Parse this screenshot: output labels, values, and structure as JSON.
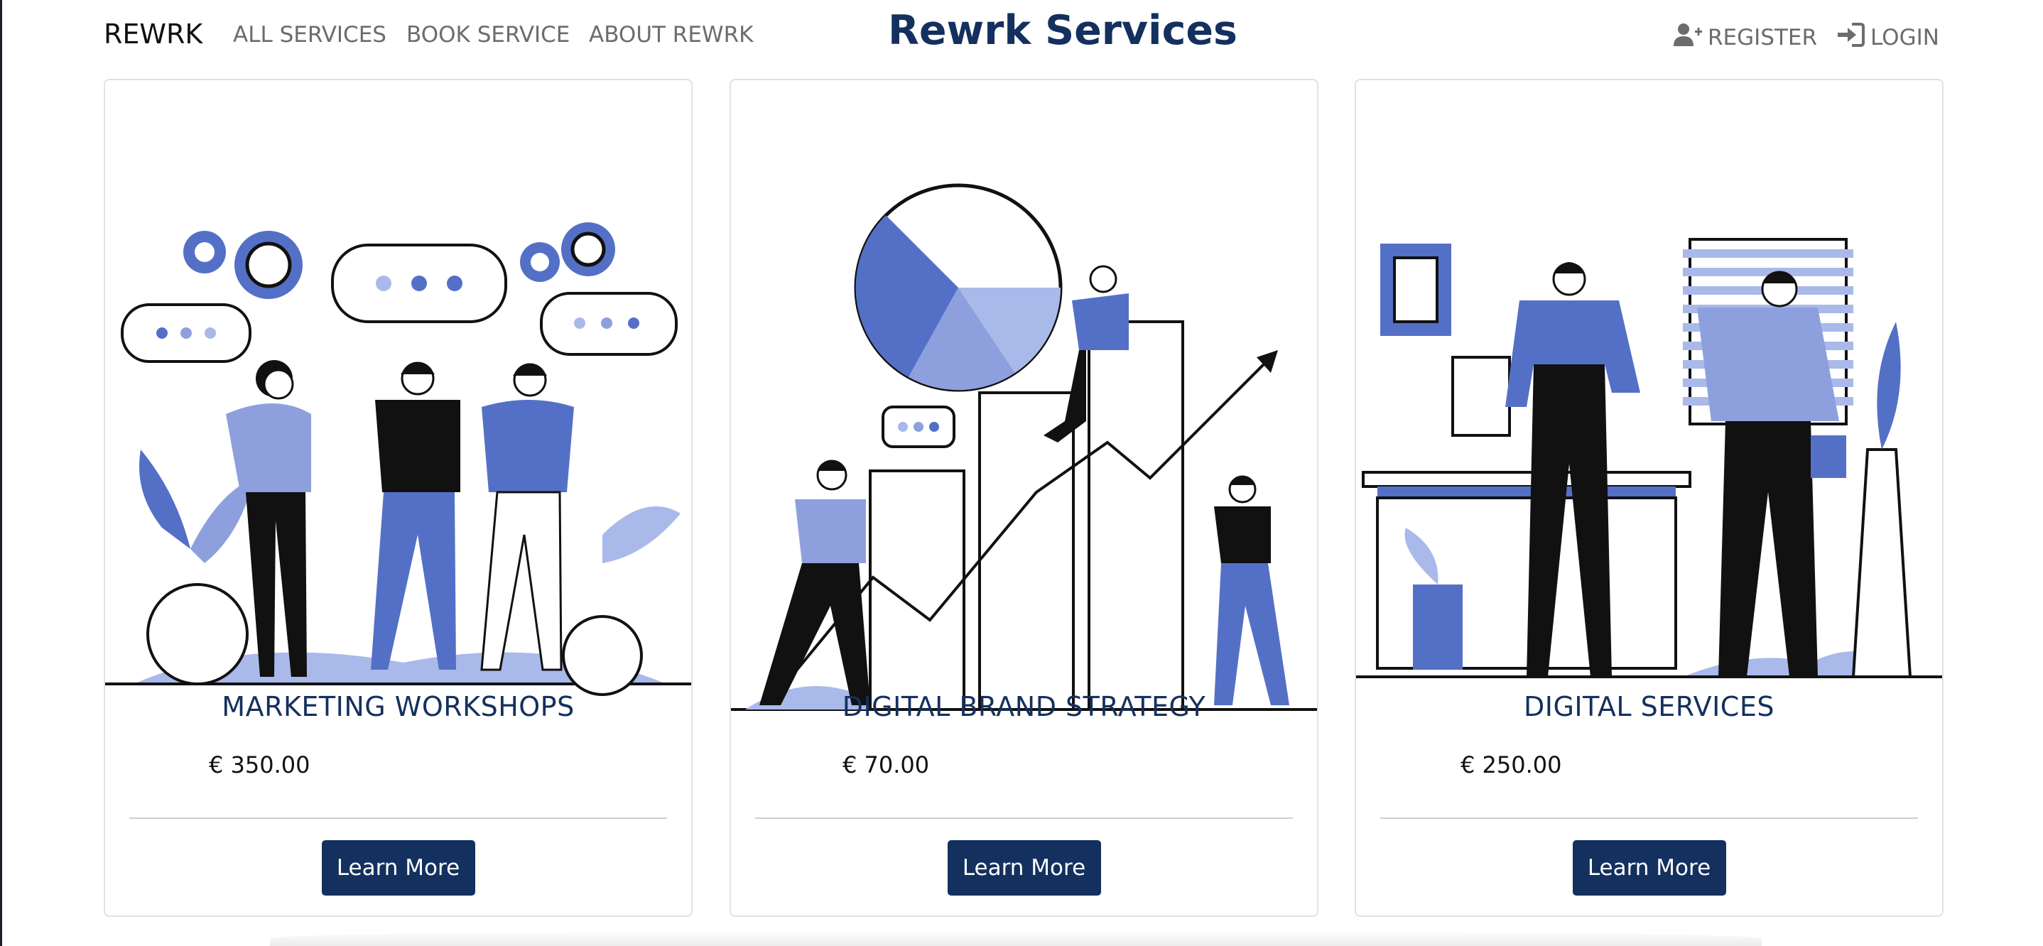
{
  "navbar": {
    "brand": "REWRK",
    "links": [
      "ALL SERVICES",
      "BOOK SERVICE",
      "ABOUT REWRK"
    ],
    "site_title": "Rewrk Services",
    "register": "REGISTER",
    "login": "LOGIN",
    "register_icon": "user-plus-icon",
    "login_icon": "sign-in-icon"
  },
  "cards": [
    {
      "title": "MARKETING WORKSHOPS",
      "price": "€ 350.00",
      "button": "Learn More",
      "illustration": "team-discussion-illustration"
    },
    {
      "title": "DIGITAL BRAND STRATEGY",
      "price": "€ 70.00",
      "button": "Learn More",
      "illustration": "growth-chart-illustration"
    },
    {
      "title": "DIGITAL SERVICES",
      "price": "€ 250.00",
      "button": "Learn More",
      "illustration": "office-handshake-illustration"
    }
  ],
  "colors": {
    "accent": "#14305e",
    "illustration_blue": "#5470c6",
    "illustration_light": "#a9b9ea"
  }
}
